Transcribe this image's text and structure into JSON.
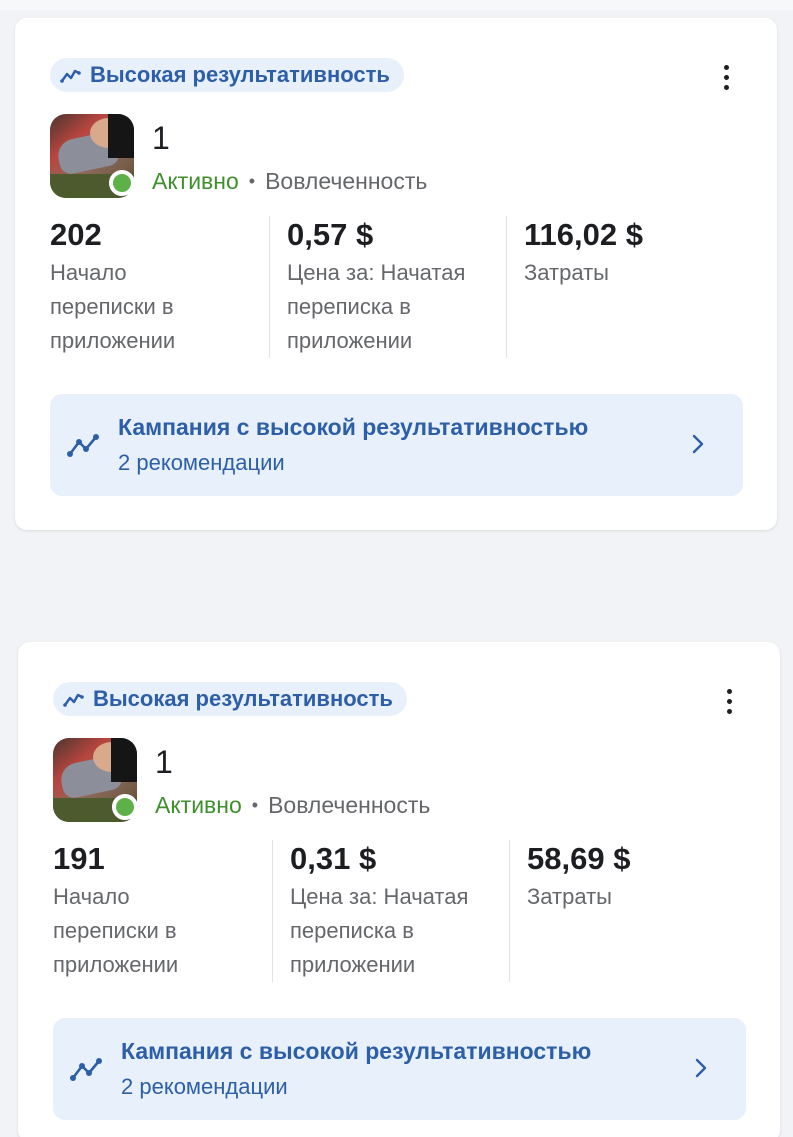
{
  "colors": {
    "accent_blue": "#2d5fa8",
    "badge_bg": "#e8f0fb",
    "active_green": "#3f8f2d",
    "status_dot": "#5db148",
    "muted_text": "#65676b"
  },
  "cards": [
    {
      "badge": {
        "icon": "trend-up-icon",
        "label": "Высокая результативность"
      },
      "more_icon": "more-vertical-icon",
      "ad": {
        "name": "1",
        "status": "Активно",
        "separator": "•",
        "objective": "Вовлеченность"
      },
      "metrics": [
        {
          "value": "202",
          "label_lines": [
            "Начало",
            "переписки в",
            "приложении"
          ]
        },
        {
          "value": "0,57 $",
          "label_lines": [
            "Цена за: Начатая",
            "переписка в",
            "приложении"
          ]
        },
        {
          "value": "116,02 $",
          "label_lines": [
            "Затраты"
          ]
        }
      ],
      "recommendation": {
        "icon": "trend-chart-icon",
        "title": "Кампания с высокой результативностью",
        "subtitle": "2 рекомендации",
        "chevron": "chevron-right-icon"
      }
    },
    {
      "badge": {
        "icon": "trend-up-icon",
        "label": "Высокая результативность"
      },
      "more_icon": "more-vertical-icon",
      "ad": {
        "name": "1",
        "status": "Активно",
        "separator": "•",
        "objective": "Вовлеченность"
      },
      "metrics": [
        {
          "value": "191",
          "label_lines": [
            "Начало",
            "переписки в",
            "приложении"
          ]
        },
        {
          "value": "0,31 $",
          "label_lines": [
            "Цена за: Начатая",
            "переписка в",
            "приложении"
          ]
        },
        {
          "value": "58,69 $",
          "label_lines": [
            "Затраты"
          ]
        }
      ],
      "recommendation": {
        "icon": "trend-chart-icon",
        "title": "Кампания с высокой результативностью",
        "subtitle": "2 рекомендации",
        "chevron": "chevron-right-icon"
      }
    }
  ]
}
